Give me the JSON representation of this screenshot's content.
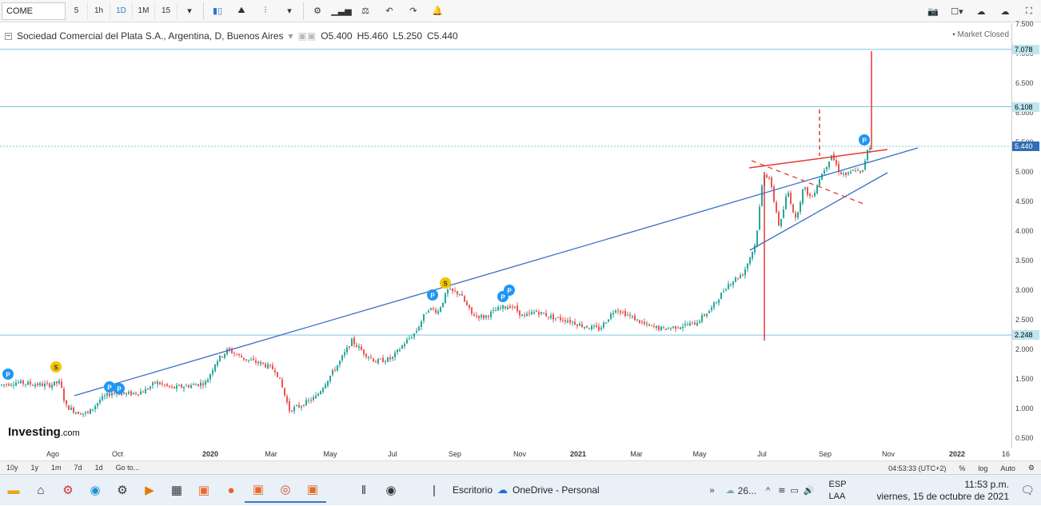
{
  "toolbar": {
    "symbol": "COME",
    "intervals": [
      "5",
      "1h",
      "1D",
      "1M",
      "15"
    ],
    "active_interval": "1D"
  },
  "legend": {
    "title": "Sociedad Comercial del Plata S.A., Argentina, D, Buenos Aires",
    "open": "O5.400",
    "high": "H5.460",
    "low": "L5.250",
    "close": "C5.440",
    "market_status": "Market Closed"
  },
  "yaxis": {
    "ticks": [
      "7.500",
      "7.000",
      "6.500",
      "6.000",
      "5.500",
      "5.000",
      "4.500",
      "4.000",
      "3.500",
      "3.000",
      "2.500",
      "2.000",
      "1.500",
      "1.000",
      "0.500"
    ],
    "tags": [
      {
        "label": "7.078",
        "value": 7.078,
        "style": "light"
      },
      {
        "label": "6.108",
        "value": 6.108,
        "style": "light"
      },
      {
        "label": "5.440",
        "value": 5.44,
        "style": "dark"
      },
      {
        "label": "2.248",
        "value": 2.248,
        "style": "light"
      }
    ]
  },
  "xaxis": {
    "ticks": [
      {
        "label": "Ago",
        "bold": false
      },
      {
        "label": "Oct",
        "bold": false
      },
      {
        "label": "2020",
        "bold": true
      },
      {
        "label": "Mar",
        "bold": false
      },
      {
        "label": "May",
        "bold": false
      },
      {
        "label": "Jul",
        "bold": false
      },
      {
        "label": "Sep",
        "bold": false
      },
      {
        "label": "Nov",
        "bold": false
      },
      {
        "label": "2021",
        "bold": true
      },
      {
        "label": "Mar",
        "bold": false
      },
      {
        "label": "May",
        "bold": false
      },
      {
        "label": "Jul",
        "bold": false
      },
      {
        "label": "Sep",
        "bold": false
      },
      {
        "label": "Nov",
        "bold": false
      },
      {
        "label": "2022",
        "bold": true
      },
      {
        "label": "16",
        "bold": false
      }
    ]
  },
  "markers": [
    {
      "label": "P",
      "color": "#2196f3"
    },
    {
      "label": "S",
      "color": "#f5c400"
    },
    {
      "label": "P",
      "color": "#2196f3"
    },
    {
      "label": "P",
      "color": "#2196f3"
    },
    {
      "label": "S",
      "color": "#f5c400"
    },
    {
      "label": "P",
      "color": "#2196f3"
    },
    {
      "label": "P",
      "color": "#2196f3"
    },
    {
      "label": "P",
      "color": "#2196f3"
    },
    {
      "label": "P",
      "color": "#2196f3"
    }
  ],
  "bottombar": {
    "ranges": [
      "10y",
      "1y",
      "1m",
      "7d",
      "1d",
      "Go to..."
    ],
    "clock": "04:53:33 (UTC+2)",
    "percent": "%",
    "log": "log",
    "auto": "Auto"
  },
  "logo": {
    "main": "Investing",
    "suffix": ".com"
  },
  "taskbar": {
    "escritorio": "Escritorio",
    "onedrive": "OneDrive - Personal",
    "weather": "26...",
    "lang1": "ESP",
    "lang2": "LAA",
    "time": "11:53 p.m.",
    "date": "viernes, 15 de octubre de 2021"
  },
  "colors": {
    "trendline": "#3a6fc6",
    "redline": "#e53935",
    "up": "#26a69a",
    "down": "#ef5350",
    "hline": "#7cc7d6"
  }
}
